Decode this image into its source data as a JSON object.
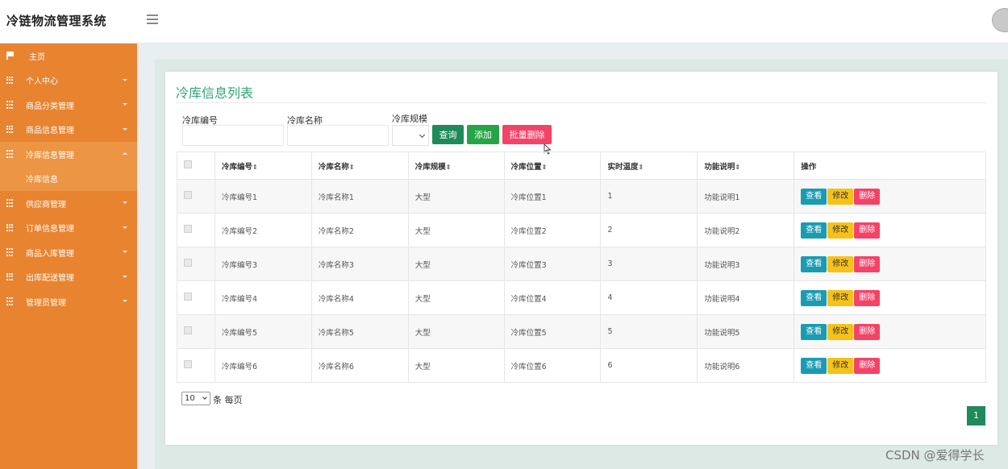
{
  "app": {
    "title": "冷链物流管理系统",
    "avatar_text": "avatar"
  },
  "sidebar": {
    "items": [
      {
        "label": "主页",
        "icon": "flag-icon",
        "expandable": false
      },
      {
        "label": "个人中心",
        "icon": "grid-icon",
        "expandable": true
      },
      {
        "label": "商品分类管理",
        "icon": "grid-icon",
        "expandable": true
      },
      {
        "label": "商品信息管理",
        "icon": "grid-icon",
        "expandable": true
      },
      {
        "label": "冷库信息管理",
        "icon": "grid-icon",
        "expandable": true,
        "expanded": true,
        "children": [
          "冷库信息"
        ]
      },
      {
        "label": "供应商管理",
        "icon": "grid-icon",
        "expandable": true
      },
      {
        "label": "订单信息管理",
        "icon": "grid-icon",
        "expandable": true
      },
      {
        "label": "商品入库管理",
        "icon": "grid-icon",
        "expandable": true
      },
      {
        "label": "出库配送管理",
        "icon": "grid-icon",
        "expandable": true
      },
      {
        "label": "管理员管理",
        "icon": "grid-icon",
        "expandable": true
      }
    ]
  },
  "main": {
    "title": "冷库信息列表",
    "search": {
      "code_label": "冷库编号",
      "code_value": "",
      "name_label": "冷库名称",
      "name_value": "",
      "scale_label": "冷库规模",
      "scale_value": ""
    },
    "buttons": {
      "query": "查询",
      "add": "添加",
      "batch_delete": "批量删除"
    },
    "table": {
      "columns": [
        "冷库编号",
        "冷库名称",
        "冷库规模",
        "冷库位置",
        "实时温度",
        "功能说明",
        "操作"
      ],
      "sort_glyph": "⇕",
      "rows": [
        [
          "冷库编号1",
          "冷库名称1",
          "大型",
          "冷库位置1",
          "1",
          "功能说明1"
        ],
        [
          "冷库编号2",
          "冷库名称2",
          "大型",
          "冷库位置2",
          "2",
          "功能说明2"
        ],
        [
          "冷库编号3",
          "冷库名称3",
          "大型",
          "冷库位置3",
          "3",
          "功能说明3"
        ],
        [
          "冷库编号4",
          "冷库名称4",
          "大型",
          "冷库位置4",
          "4",
          "功能说明4"
        ],
        [
          "冷库编号5",
          "冷库名称5",
          "大型",
          "冷库位置5",
          "5",
          "功能说明5"
        ],
        [
          "冷库编号6",
          "冷库名称6",
          "大型",
          "冷库位置6",
          "6",
          "功能说明6"
        ]
      ],
      "actions": {
        "view": "查看",
        "edit": "修改",
        "delete": "删除"
      }
    },
    "pagination": {
      "page_size": "10",
      "per_page_label": "条 每页",
      "current_page": "1"
    }
  },
  "watermark": "CSDN @爱得学长",
  "colors": {
    "sidebar": "#e88330",
    "accent_green": "#1f8a5a",
    "title_green": "#2fa476",
    "danger": "#f44368",
    "info": "#1a9bb2",
    "warning": "#f6c21a"
  }
}
